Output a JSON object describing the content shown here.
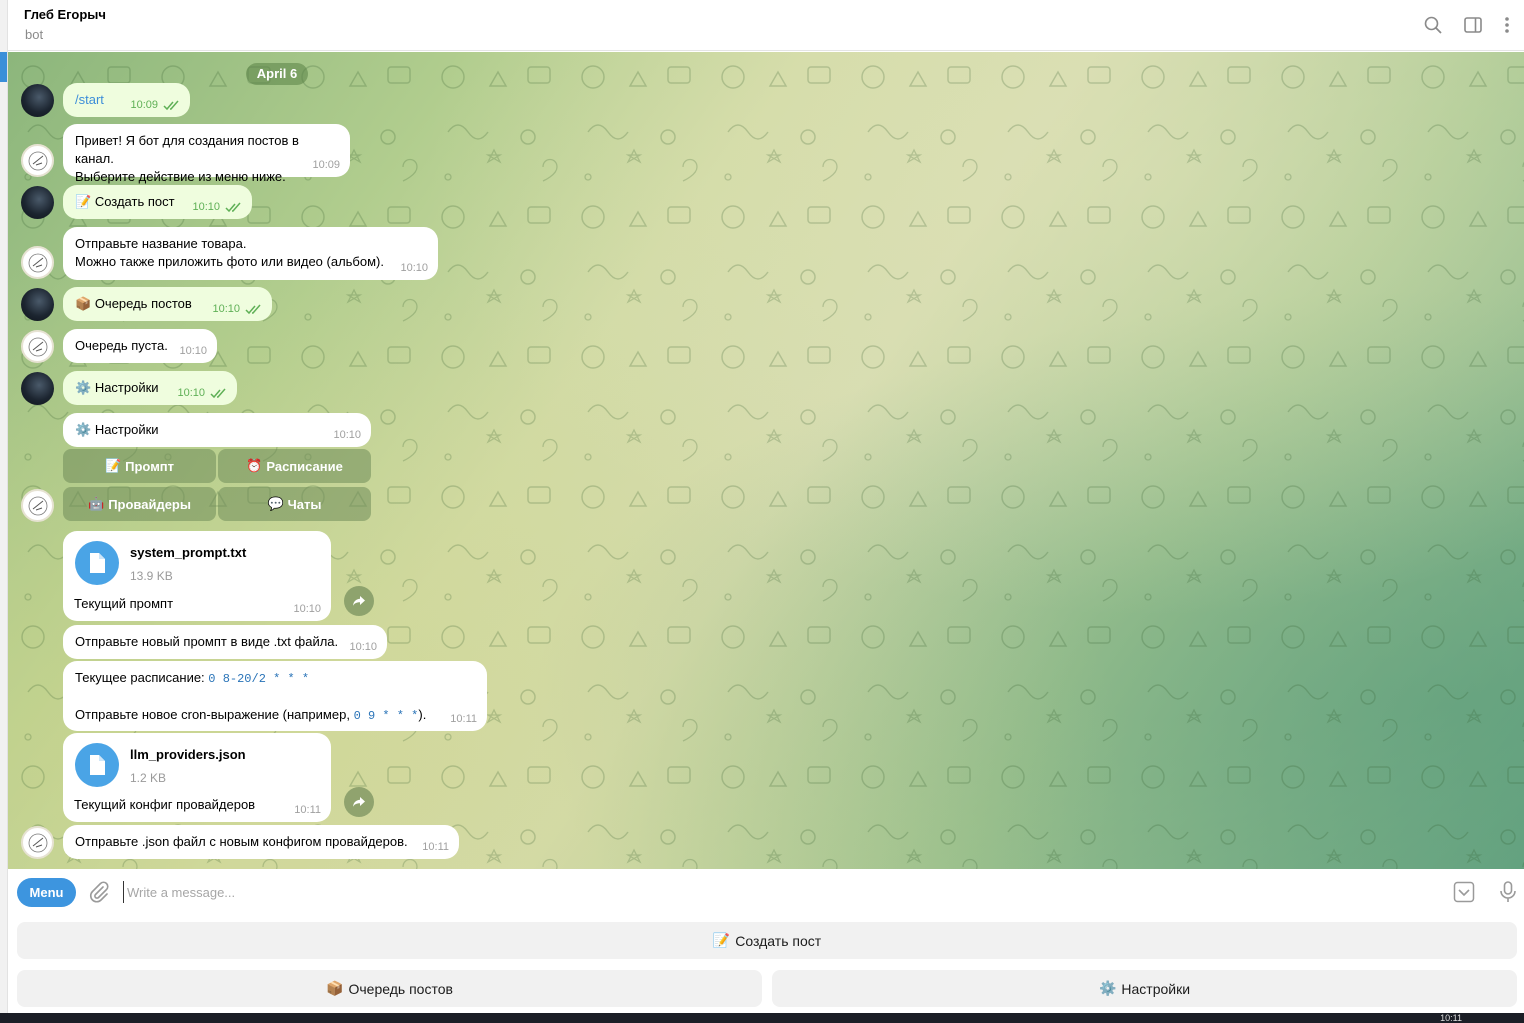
{
  "header": {
    "title": "Глеб Егорыч",
    "status": "bot",
    "icons": [
      "search-icon",
      "sidebar-toggle-icon",
      "more-vertical-icon"
    ]
  },
  "chat": {
    "date": "April 6",
    "messages": [
      {
        "id": "m1",
        "dir": "out",
        "text": "/start",
        "time": "10:09",
        "read": true
      },
      {
        "id": "m2",
        "dir": "in",
        "line1": "Привет! Я бот для создания постов в канал.",
        "line2": "Выберите действие из меню ниже.",
        "time": "10:09"
      },
      {
        "id": "m3",
        "dir": "out",
        "emoji": "📝",
        "text": "Создать пост",
        "time": "10:10",
        "read": true
      },
      {
        "id": "m4",
        "dir": "in",
        "line1": "Отправьте название товара.",
        "line2": "Можно также приложить фото или видео (альбом).",
        "time": "10:10"
      },
      {
        "id": "m5",
        "dir": "out",
        "emoji": "📦",
        "text": "Очередь постов",
        "time": "10:10",
        "read": true
      },
      {
        "id": "m6",
        "dir": "in",
        "text": "Очередь пуста.",
        "time": "10:10"
      },
      {
        "id": "m7",
        "dir": "out",
        "emoji": "⚙️",
        "text": "Настройки",
        "time": "10:10",
        "read": true
      },
      {
        "id": "m8",
        "dir": "in",
        "emoji": "⚙️",
        "text": "Настройки",
        "time": "10:10"
      },
      {
        "id": "m9",
        "dir": "in",
        "file_name": "system_prompt.txt",
        "file_size": "13.9 KB",
        "caption": "Текущий промпт",
        "time": "10:10"
      },
      {
        "id": "m10",
        "dir": "in",
        "text": "Отправьте новый промпт в виде .txt файла.",
        "time": "10:10"
      },
      {
        "id": "m11",
        "dir": "in",
        "line1_prefix": "Текущее расписание:",
        "line1_code": "0 8-20/2 * * *",
        "line2_prefix": "Отправьте новое cron-выражение (например,",
        "line2_code": "0 9 * * *",
        "line2_suffix": ").",
        "time": "10:11"
      },
      {
        "id": "m12",
        "dir": "in",
        "file_name": "llm_providers.json",
        "file_size": "1.2 KB",
        "caption": "Текущий конфиг провайдеров",
        "time": "10:11"
      },
      {
        "id": "m13",
        "dir": "in",
        "text": "Отправьте .json файл с новым конфигом провайдеров.",
        "time": "10:11"
      }
    ],
    "inline_keyboard": [
      {
        "emoji": "📝",
        "label": "Промпт"
      },
      {
        "emoji": "⏰",
        "label": "Расписание"
      },
      {
        "emoji": "🤖",
        "label": "Провайдеры"
      },
      {
        "emoji": "💬",
        "label": "Чаты"
      }
    ]
  },
  "composer": {
    "menu_label": "Menu",
    "placeholder": "Write a message..."
  },
  "reply_keyboard": [
    {
      "emoji": "📝",
      "label": "Создать пост"
    },
    {
      "emoji": "📦",
      "label": "Очередь постов"
    },
    {
      "emoji": "⚙️",
      "label": "Настройки"
    }
  ],
  "taskbar": {
    "clock": "10:11"
  },
  "colors": {
    "accent": "#3d95df",
    "outgoing_bubble": "#effdde",
    "incoming_bubble": "#ffffff",
    "read_ticks": "#5fb056"
  }
}
